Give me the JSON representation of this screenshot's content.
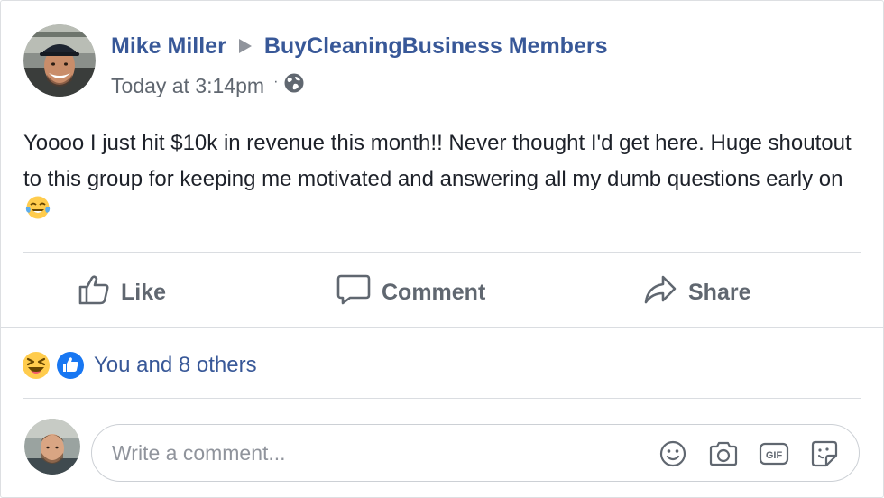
{
  "post": {
    "author": "Mike Miller",
    "group": "BuyCleaningBusiness Members",
    "timestamp": "Today at 3:14pm",
    "separator": "·",
    "audience_icon": "globe-icon",
    "text": "Yoooo I just hit $10k in revenue this month!! Never thought I'd get here. Huge shoutout to this group for keeping me motivated and answering all my dumb questions early on",
    "text_emoji": "tears-of-joy-emoji"
  },
  "actions": {
    "like_label": "Like",
    "comment_label": "Comment",
    "share_label": "Share"
  },
  "reactions": {
    "icons": [
      "laughing-emoji",
      "like-reaction-icon"
    ],
    "summary": "You and 8 others"
  },
  "comment_box": {
    "placeholder": "Write a comment...",
    "icons": [
      "smiley-icon",
      "camera-icon",
      "gif-icon",
      "sticker-icon"
    ]
  },
  "colors": {
    "link_blue": "#385898",
    "muted_gray": "#606770",
    "like_blue": "#1877f2",
    "emoji_yellow": "#ffcc4d",
    "border": "#dadde1"
  }
}
